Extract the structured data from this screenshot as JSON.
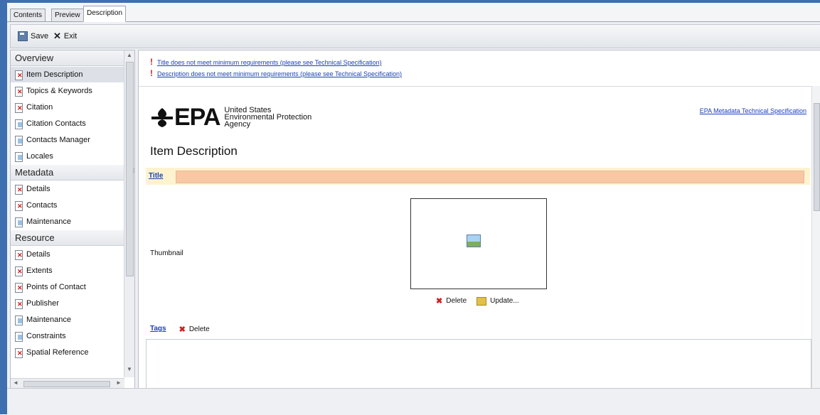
{
  "tabs": [
    "Contents",
    "Preview",
    "Description"
  ],
  "toolbar": {
    "save_label": "Save",
    "exit_label": "Exit"
  },
  "nav": {
    "sections": [
      {
        "title": "Overview",
        "items": [
          {
            "label": "Item Description",
            "status": "error",
            "selected": true
          },
          {
            "label": "Topics & Keywords",
            "status": "error"
          },
          {
            "label": "Citation",
            "status": "error"
          },
          {
            "label": "Citation Contacts",
            "status": "ok"
          },
          {
            "label": "Contacts Manager",
            "status": "ok"
          },
          {
            "label": "Locales",
            "status": "ok"
          }
        ]
      },
      {
        "title": "Metadata",
        "items": [
          {
            "label": "Details",
            "status": "error"
          },
          {
            "label": "Contacts",
            "status": "error"
          },
          {
            "label": "Maintenance",
            "status": "ok"
          }
        ]
      },
      {
        "title": "Resource",
        "items": [
          {
            "label": "Details",
            "status": "error"
          },
          {
            "label": "Extents",
            "status": "error"
          },
          {
            "label": "Points of Contact",
            "status": "error"
          },
          {
            "label": "Publisher",
            "status": "error"
          },
          {
            "label": "Maintenance",
            "status": "ok"
          },
          {
            "label": "Constraints",
            "status": "ok"
          },
          {
            "label": "Spatial Reference",
            "status": "error"
          }
        ]
      }
    ]
  },
  "warnings": [
    "Title does not meet minimum requirements (please see Technical Specification)",
    "Description does not meet minimum requirements (please see Technical Specification)"
  ],
  "logo": {
    "mark": "EPA",
    "line1": "United States",
    "line2": "Environmental Protection",
    "line3": "Agency"
  },
  "spec_link": "EPA Metadata Technical Specification",
  "page_title": "Item Description",
  "title_field": {
    "label": "Title",
    "value": ""
  },
  "thumbnail": {
    "label": "Thumbnail",
    "delete_label": "Delete",
    "update_label": "Update..."
  },
  "tags": {
    "label": "Tags",
    "delete_label": "Delete",
    "value": ""
  },
  "colors": {
    "window_frame": "#3e6fb0",
    "title_row": "#fdf3cf",
    "title_input": "#f7c8a3",
    "error_icon": "#d01818",
    "link": "#1a3fb8"
  }
}
